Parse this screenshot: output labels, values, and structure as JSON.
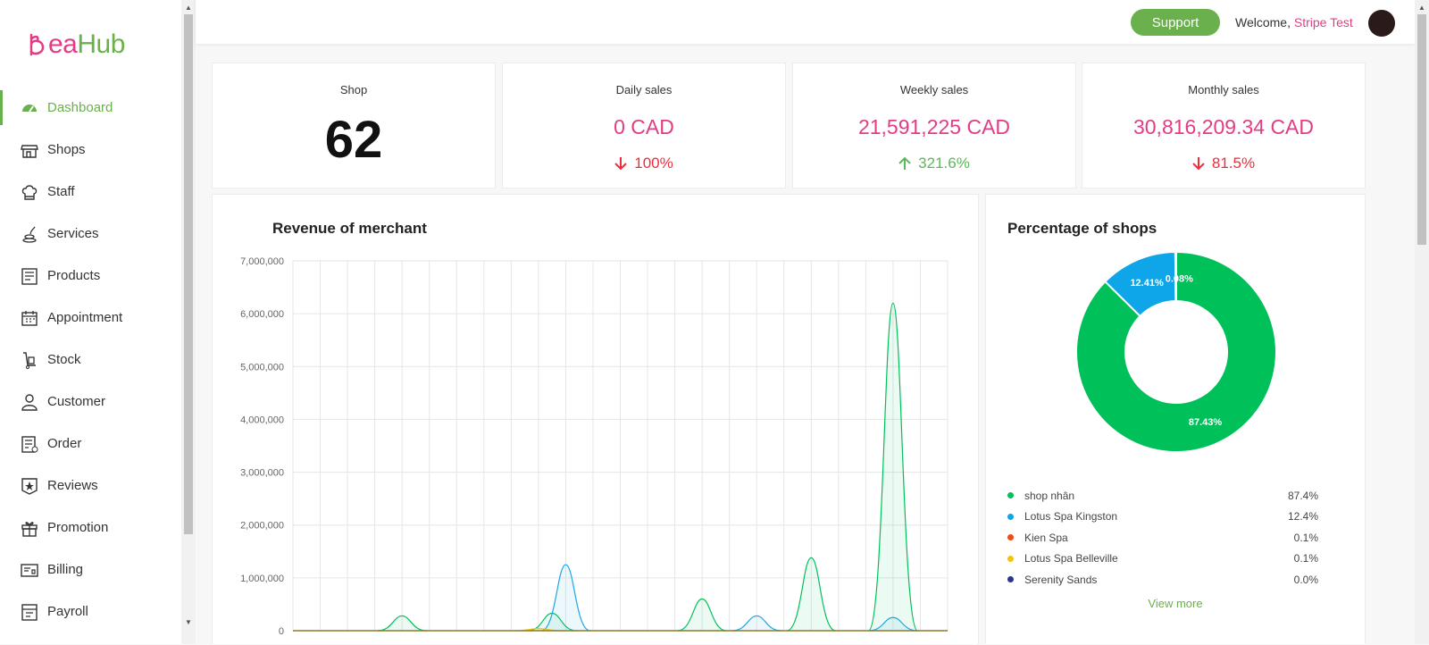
{
  "brand": {
    "logo_initial": "B",
    "logo_ea": "ea",
    "logo_hub": "Hub"
  },
  "sidebar": {
    "items": [
      {
        "label": "Dashboard",
        "icon": "speedometer-icon",
        "active": true
      },
      {
        "label": "Shops",
        "icon": "storefront-icon"
      },
      {
        "label": "Staff",
        "icon": "chef-hat-icon"
      },
      {
        "label": "Services",
        "icon": "spa-stones-icon"
      },
      {
        "label": "Products",
        "icon": "product-list-icon"
      },
      {
        "label": "Appointment",
        "icon": "calendar-icon"
      },
      {
        "label": "Stock",
        "icon": "hand-truck-icon"
      },
      {
        "label": "Customer",
        "icon": "user-icon"
      },
      {
        "label": "Order",
        "icon": "order-sheet-icon"
      },
      {
        "label": "Reviews",
        "icon": "star-badge-icon"
      },
      {
        "label": "Promotion",
        "icon": "gift-icon"
      },
      {
        "label": "Billing",
        "icon": "bill-icon"
      },
      {
        "label": "Payroll",
        "icon": "payroll-icon"
      }
    ]
  },
  "header": {
    "support_label": "Support",
    "welcome_prefix": "Welcome, ",
    "user_name": "Stripe Test"
  },
  "stats": {
    "shop": {
      "title": "Shop",
      "value": "62"
    },
    "daily": {
      "title": "Daily sales",
      "value": "0 CAD",
      "change": "100%",
      "direction": "down"
    },
    "weekly": {
      "title": "Weekly sales",
      "value": "21,591,225 CAD",
      "change": "321.6%",
      "direction": "up"
    },
    "monthly": {
      "title": "Monthly sales",
      "value": "30,816,209.34 CAD",
      "change": "81.5%",
      "direction": "down"
    }
  },
  "revenue": {
    "title": "Revenue of merchant"
  },
  "chart_data": [
    {
      "type": "area",
      "title": "Revenue of merchant",
      "ylim": [
        0,
        7000000
      ],
      "yticks": [
        "7,000,000",
        "6,000,000",
        "5,000,000",
        "4,000,000",
        "3,000,000",
        "2,000,000",
        "1,000,000",
        "0"
      ],
      "grid": true,
      "series": [
        {
          "color": "#00c05a",
          "peaks": [
            {
              "x": 4,
              "y": 280000
            },
            {
              "x": 9.5,
              "y": 330000
            },
            {
              "x": 15,
              "y": 600000
            },
            {
              "x": 19,
              "y": 1380000
            },
            {
              "x": 22,
              "y": 6200000
            }
          ]
        },
        {
          "color": "#1ea7e4",
          "peaks": [
            {
              "x": 10,
              "y": 1250000
            },
            {
              "x": 17,
              "y": 280000
            },
            {
              "x": 22,
              "y": 250000
            }
          ]
        },
        {
          "color": "#f4c20d",
          "peaks": [
            {
              "x": 9,
              "y": 40000
            }
          ]
        }
      ]
    },
    {
      "type": "pie",
      "title": "Percentage of shops",
      "slices": [
        {
          "label": "shop nhân",
          "value": 87.43,
          "pct": "87.4%",
          "slice_label": "87.43%",
          "color": "#00c05a"
        },
        {
          "label": "Lotus Spa Kingston",
          "value": 12.41,
          "pct": "12.4%",
          "slice_label": "12.41%",
          "color": "#0ea5e9"
        },
        {
          "label": "Kien Spa",
          "value": 0.08,
          "pct": "0.1%",
          "slice_label": "0.08%",
          "color": "#ef4b16"
        },
        {
          "label": "Lotus Spa Belleville",
          "value": 0.06,
          "pct": "0.1%",
          "slice_label": "",
          "color": "#f4c20d"
        },
        {
          "label": "Serenity Sands",
          "value": 0.02,
          "pct": "0.0%",
          "slice_label": "",
          "color": "#283593"
        }
      ]
    }
  ],
  "shops_panel": {
    "title": "Percentage of shops",
    "view_more": "View more"
  }
}
